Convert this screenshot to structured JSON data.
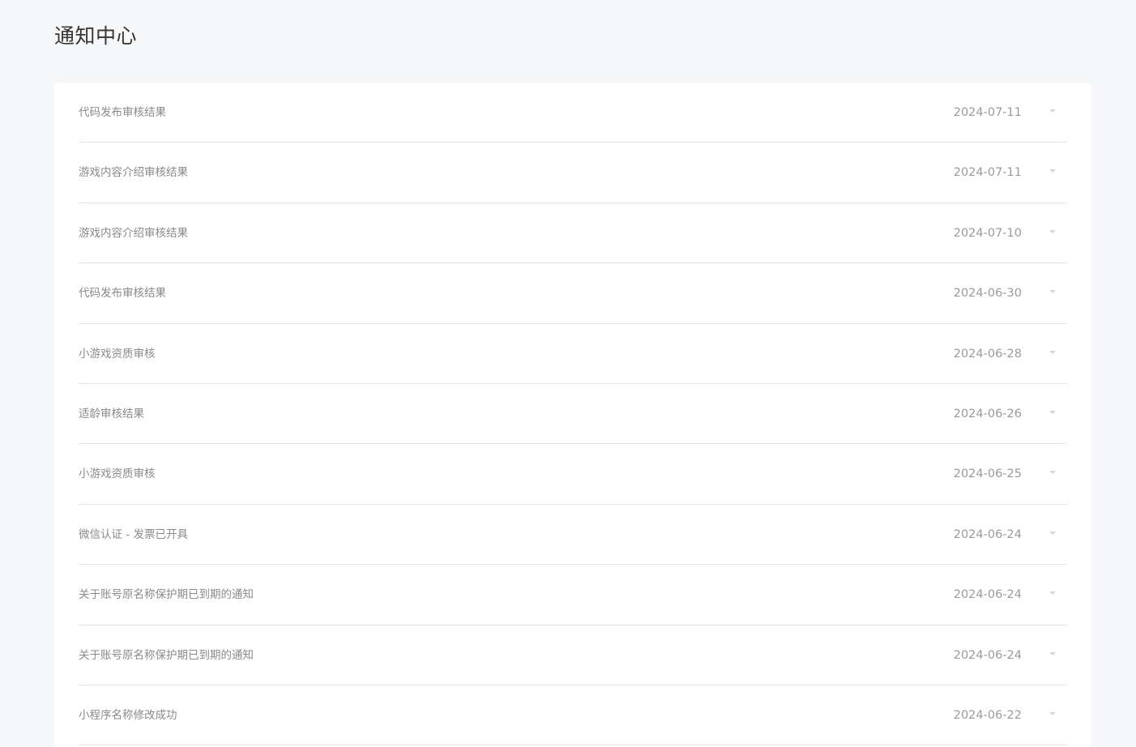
{
  "page": {
    "title": "通知中心"
  },
  "notifications": [
    {
      "title": "代码发布审核结果",
      "date": "2024-07-11"
    },
    {
      "title": "游戏内容介绍审核结果",
      "date": "2024-07-11"
    },
    {
      "title": "游戏内容介绍审核结果",
      "date": "2024-07-10"
    },
    {
      "title": "代码发布审核结果",
      "date": "2024-06-30"
    },
    {
      "title": "小游戏资质审核",
      "date": "2024-06-28"
    },
    {
      "title": "适龄审核结果",
      "date": "2024-06-26"
    },
    {
      "title": "小游戏资质审核",
      "date": "2024-06-25"
    },
    {
      "title": "微信认证 - 发票已开具",
      "date": "2024-06-24"
    },
    {
      "title": "关于账号原名称保护期已到期的通知",
      "date": "2024-06-24"
    },
    {
      "title": "关于账号原名称保护期已到期的通知",
      "date": "2024-06-24"
    },
    {
      "title": "小程序名称修改成功",
      "date": "2024-06-22"
    }
  ],
  "icons": {
    "expand": "chevron-down-icon"
  },
  "colors": {
    "background": "#f6f7f9",
    "panel": "#ffffff",
    "title_text": "#353535",
    "item_text": "#8a8a8a",
    "date_text": "#9a9a9a",
    "divider": "#e5e5e5"
  }
}
